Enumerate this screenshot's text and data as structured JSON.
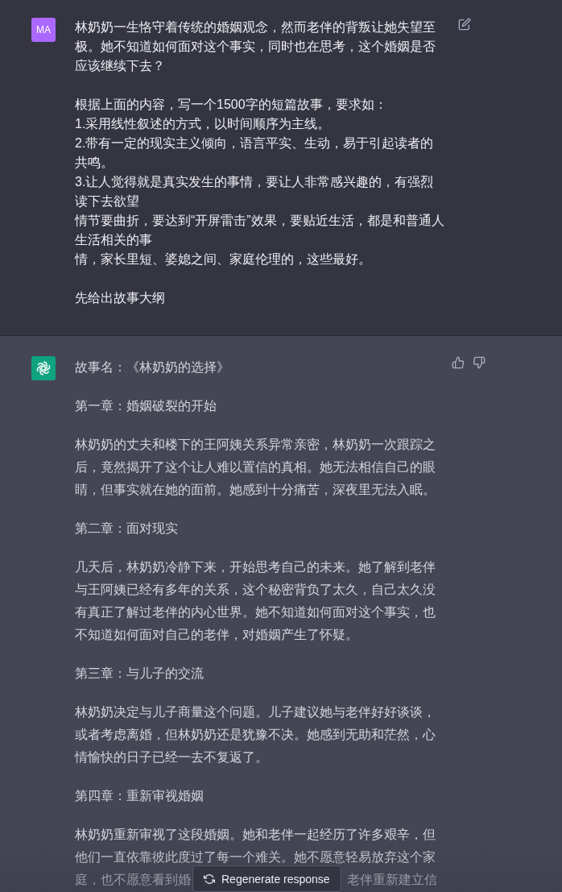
{
  "messages": [
    {
      "kind": "user",
      "avatar": "MA",
      "blocks": [
        [
          "林奶奶一生恪守着传统的婚姻观念，然而老伴的背叛让她失望至极。她不知道如何面对这个事实，同时也在思考，这个婚姻是否应该继续下去？"
        ],
        [
          "根据上面的内容，写一个1500字的短篇故事，要求如：",
          "1.采用线性叙述的方式，以时间顺序为主线。",
          "2.带有一定的现实主义倾向，语言平实、生动，易于引起读者的共鸣。",
          "3.让人觉得就是真实发生的事情，要让人非常感兴趣的，有强烈读下去欲望",
          "情节要曲折，要达到“开屏雷击”效果，要贴近生活，都是和普通人生活相关的事",
          "情，家长里短、婆媳之间、家庭伦理的，这些最好。"
        ],
        [
          "先给出故事大纲"
        ]
      ]
    },
    {
      "kind": "assistant",
      "paragraphs": [
        "故事名：《林奶奶的选择》",
        "第一章：婚姻破裂的开始",
        "林奶奶的丈夫和楼下的王阿姨关系异常亲密，林奶奶一次跟踪之后，竟然揭开了这个让人难以置信的真相。她无法相信自己的眼睛，但事实就在她的面前。她感到十分痛苦，深夜里无法入眠。",
        "第二章：面对现实",
        "几天后，林奶奶冷静下来，开始思考自己的未来。她了解到老伴与王阿姨已经有多年的关系，这个秘密背负了太久，自己太久没有真正了解过老伴的内心世界。她不知道如何面对这个事实，也不知道如何面对自己的老伴，对婚姻产生了怀疑。",
        "第三章：与儿子的交流",
        "林奶奶决定与儿子商量这个问题。儿子建议她与老伴好好谈谈，或者考虑离婚，但林奶奶还是犹豫不决。她感到无助和茫然，心情愉快的日子已经一去不复返了。",
        "第四章：重新审视婚姻"
      ],
      "last_paragraph": {
        "text": "林奶奶重新审视了这段婚姻。她和老伴一起经历了许多艰辛，但他们一直依靠彼此度过了每一个难关。她不愿意轻易放弃这个家",
        "cut_left": "庭，也不愿意看到婚",
        "cut_right": "老伴重新建立信"
      }
    }
  ],
  "regenerate_button": "Regenerate response"
}
